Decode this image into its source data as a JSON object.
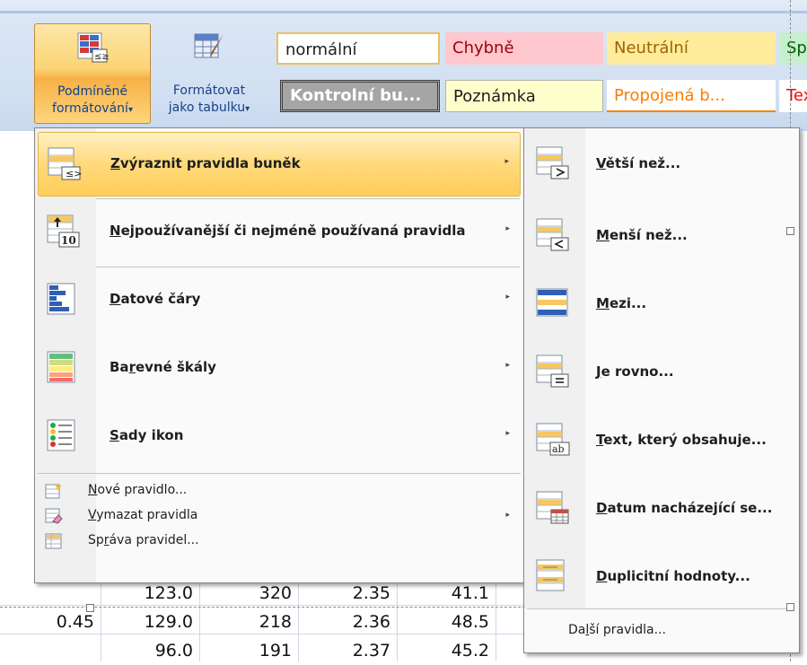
{
  "ribbon": {
    "conditional_formatting": {
      "line1": "Podmíněné",
      "line2": "formátování",
      "dropdown": "▾"
    },
    "format_as_table": {
      "line1": "Formátovat",
      "line2": "jako tabulku",
      "dropdown": "▾"
    },
    "styles": {
      "normal": "normální",
      "bad": "Chybně",
      "neutral": "Neutrální",
      "good": "Spr",
      "check_cell": "Kontrolní bu...",
      "note": "Poznámka",
      "linked_cell": "Propojená b...",
      "warning": "Tex"
    }
  },
  "menu": {
    "items": [
      {
        "key": "Z",
        "rest": "výraznit pravidla buněk",
        "arrow": "▸"
      },
      {
        "key": "N",
        "rest": "ejpoužívanější či nejméně používaná pravidla",
        "arrow": "▸"
      },
      {
        "key": "D",
        "rest": "atové čáry",
        "arrow": "▸"
      },
      {
        "pre": "Ba",
        "key": "r",
        "rest": "evné škály",
        "arrow": "▸"
      },
      {
        "key": "S",
        "rest": "ady ikon",
        "arrow": "▸"
      }
    ],
    "small_items": [
      {
        "key": "N",
        "rest": "ové pravidlo..."
      },
      {
        "key": "V",
        "rest": "ymazat pravidla",
        "arrow": "▸"
      },
      {
        "pre": "Sp",
        "key": "r",
        "rest": "áva pravidel..."
      }
    ]
  },
  "submenu": {
    "items": [
      {
        "key": "V",
        "rest": "ětší než..."
      },
      {
        "key": "M",
        "rest": "enší než..."
      },
      {
        "key": "M",
        "rest": "ezi..."
      },
      {
        "key": "J",
        "rest": "e rovno..."
      },
      {
        "key": "T",
        "rest": "ext, který obsahuje..."
      },
      {
        "key": "D",
        "rest": "atum nacházející se..."
      },
      {
        "key": "D",
        "rest": "uplicitní hodnoty..."
      }
    ],
    "more": {
      "pre": "Da",
      "key": "l",
      "rest": "ší pravidla..."
    }
  },
  "sheet": {
    "rows": [
      [
        "",
        "123.0",
        "320",
        "2.35",
        "41.1"
      ],
      [
        "0.45",
        "129.0",
        "218",
        "2.36",
        "48.5"
      ],
      [
        "",
        "96.0",
        "191",
        "2.37",
        "45.2"
      ]
    ]
  },
  "colors": {
    "highlight": "#ffd97a",
    "ribbon": "#dbe6f4",
    "accent_text": "#15428b"
  }
}
